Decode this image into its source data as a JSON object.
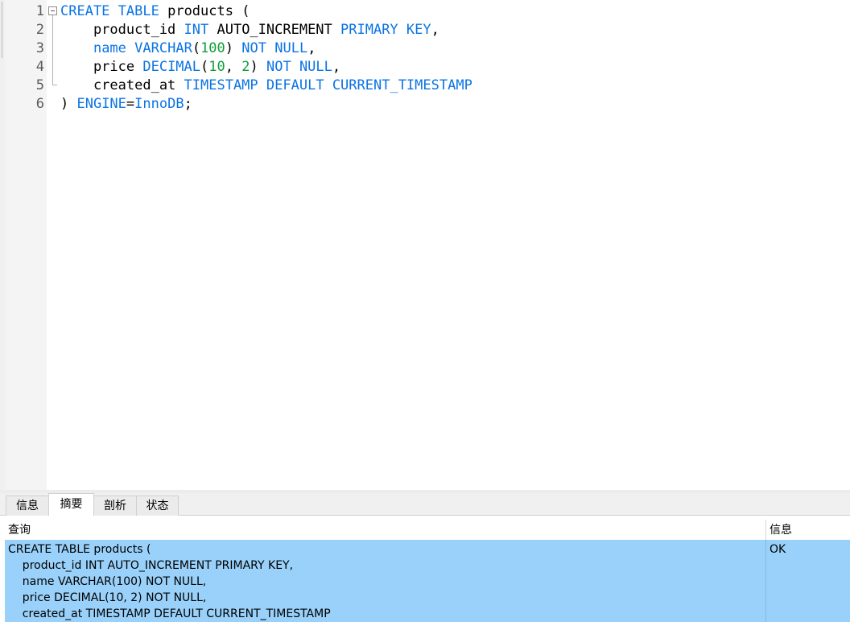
{
  "editor": {
    "line_numbers": [
      "1",
      "2",
      "3",
      "4",
      "5",
      "6"
    ],
    "lines": [
      [
        {
          "t": "CREATE",
          "k": "kw"
        },
        {
          "t": " "
        },
        {
          "t": "TABLE",
          "k": "kw"
        },
        {
          "t": " products ("
        }
      ],
      [
        {
          "t": "    product_id "
        },
        {
          "t": "INT",
          "k": "kw"
        },
        {
          "t": " AUTO_INCREMENT "
        },
        {
          "t": "PRIMARY",
          "k": "kw"
        },
        {
          "t": " "
        },
        {
          "t": "KEY",
          "k": "kw"
        },
        {
          "t": ","
        }
      ],
      [
        {
          "t": "    "
        },
        {
          "t": "name",
          "k": "kw"
        },
        {
          "t": " "
        },
        {
          "t": "VARCHAR",
          "k": "kw"
        },
        {
          "t": "("
        },
        {
          "t": "100",
          "k": "num"
        },
        {
          "t": ") "
        },
        {
          "t": "NOT",
          "k": "kw"
        },
        {
          "t": " "
        },
        {
          "t": "NULL",
          "k": "kw"
        },
        {
          "t": ","
        }
      ],
      [
        {
          "t": "    price "
        },
        {
          "t": "DECIMAL",
          "k": "kw"
        },
        {
          "t": "("
        },
        {
          "t": "10",
          "k": "num"
        },
        {
          "t": ", "
        },
        {
          "t": "2",
          "k": "num"
        },
        {
          "t": ") "
        },
        {
          "t": "NOT",
          "k": "kw"
        },
        {
          "t": " "
        },
        {
          "t": "NULL",
          "k": "kw"
        },
        {
          "t": ","
        }
      ],
      [
        {
          "t": "    created_at "
        },
        {
          "t": "TIMESTAMP",
          "k": "kw"
        },
        {
          "t": " "
        },
        {
          "t": "DEFAULT",
          "k": "kw"
        },
        {
          "t": " "
        },
        {
          "t": "CURRENT_TIMESTAMP",
          "k": "kw"
        }
      ],
      [
        {
          "t": ") "
        },
        {
          "t": "ENGINE",
          "k": "kw"
        },
        {
          "t": "="
        },
        {
          "t": "InnoDB",
          "k": "kw"
        },
        {
          "t": ";"
        }
      ]
    ]
  },
  "tabs": [
    {
      "label": "信息",
      "active": false
    },
    {
      "label": "摘要",
      "active": true
    },
    {
      "label": "剖析",
      "active": false
    },
    {
      "label": "状态",
      "active": false
    }
  ],
  "results": {
    "headers": {
      "query": "查询",
      "info": "信息"
    },
    "row": {
      "query_lines": [
        "CREATE TABLE products (",
        "    product_id INT AUTO_INCREMENT PRIMARY KEY,",
        "    name VARCHAR(100) NOT NULL,",
        "    price DECIMAL(10, 2) NOT NULL,",
        "    created_at TIMESTAMP DEFAULT CURRENT_TIMESTAMP"
      ],
      "info": "OK"
    }
  },
  "colors": {
    "keyword": "#0b74e4",
    "number": "#0f9d3a",
    "selected_row": "#99d1fa"
  }
}
